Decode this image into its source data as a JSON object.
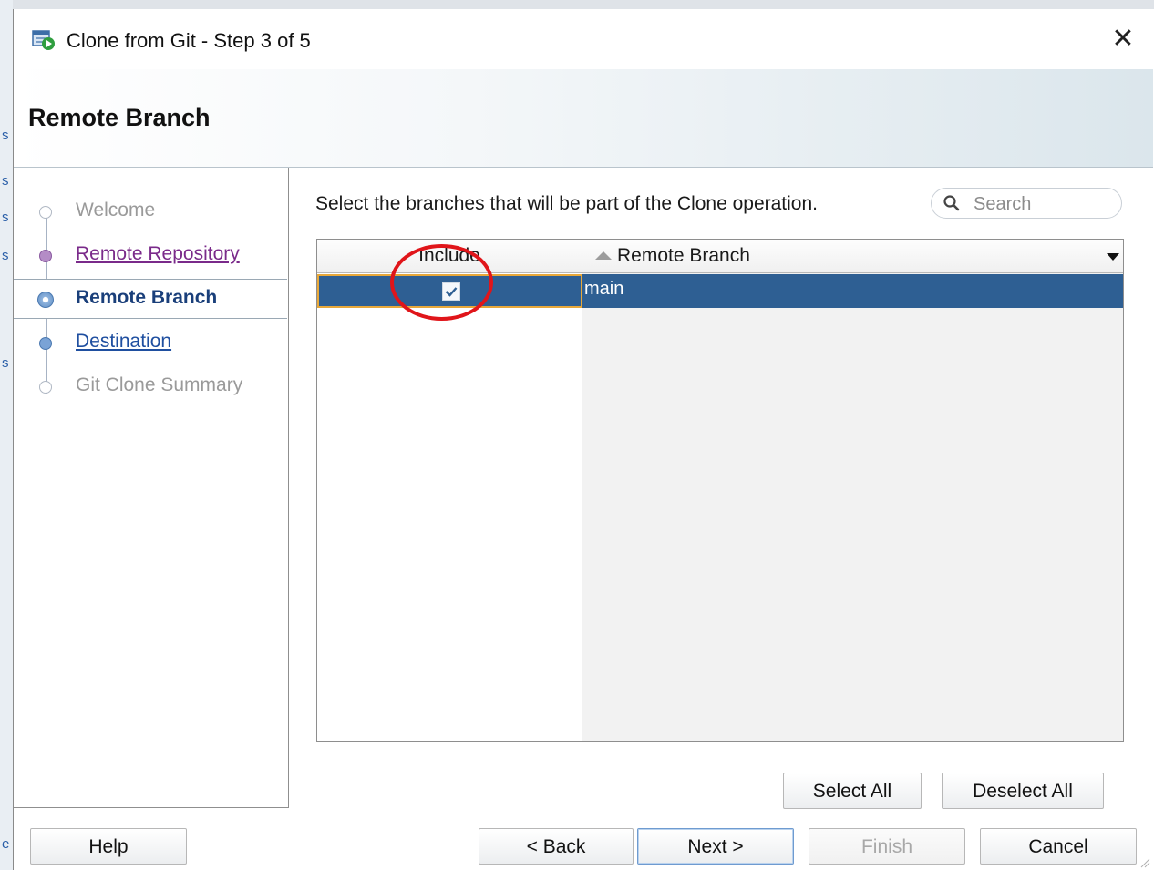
{
  "dialog": {
    "title": "Clone from Git - Step 3 of 5",
    "header_title": "Remote Branch"
  },
  "steps": [
    {
      "label": "Welcome",
      "state": "visited"
    },
    {
      "label": "Remote Repository",
      "state": "done"
    },
    {
      "label": "Remote Branch",
      "state": "current"
    },
    {
      "label": "Destination",
      "state": "link"
    },
    {
      "label": "Git Clone Summary",
      "state": "pending"
    }
  ],
  "content": {
    "instruction": "Select the branches that will be part of the Clone operation.",
    "search_placeholder": "Search"
  },
  "table": {
    "columns": [
      "Include",
      "Remote Branch"
    ],
    "sort_column": "Remote Branch",
    "rows": [
      {
        "include": true,
        "branch": "main",
        "selected": true
      }
    ]
  },
  "buttons": {
    "select_all": "Select All",
    "deselect_all": "Deselect All",
    "help": "Help",
    "back": "< Back",
    "next": "Next >",
    "finish": "Finish",
    "cancel": "Cancel"
  },
  "colors": {
    "selection": "#2e5f93",
    "annotation": "#e0151a",
    "current_step": "#1a3f7a"
  }
}
